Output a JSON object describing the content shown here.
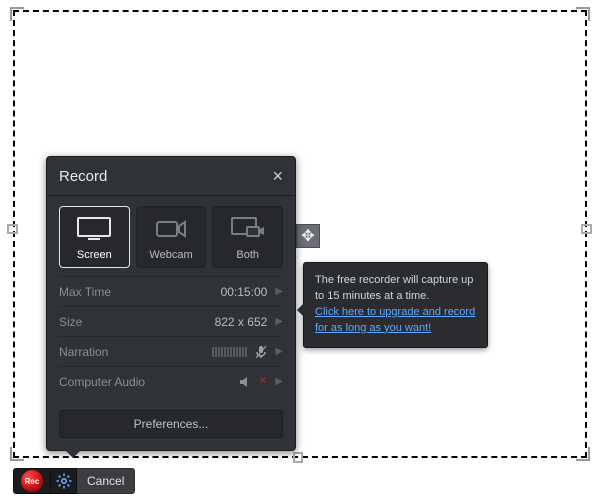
{
  "panel": {
    "title": "Record",
    "sources": [
      {
        "id": "screen",
        "label": "Screen",
        "active": true
      },
      {
        "id": "webcam",
        "label": "Webcam",
        "active": false
      },
      {
        "id": "both",
        "label": "Both",
        "active": false
      }
    ],
    "rows": {
      "max_time": {
        "label": "Max Time",
        "value": "00:15:00"
      },
      "size": {
        "label": "Size",
        "value": "822 x 652"
      },
      "narration": {
        "label": "Narration"
      },
      "audio": {
        "label": "Computer Audio"
      }
    },
    "preferences_label": "Preferences..."
  },
  "tooltip": {
    "text": "The free recorder will capture up to 15 minutes at a time.",
    "link_text": "Click here to upgrade and record for as long as you want!"
  },
  "toolbar": {
    "rec_label": "Rec",
    "cancel_label": "Cancel"
  }
}
